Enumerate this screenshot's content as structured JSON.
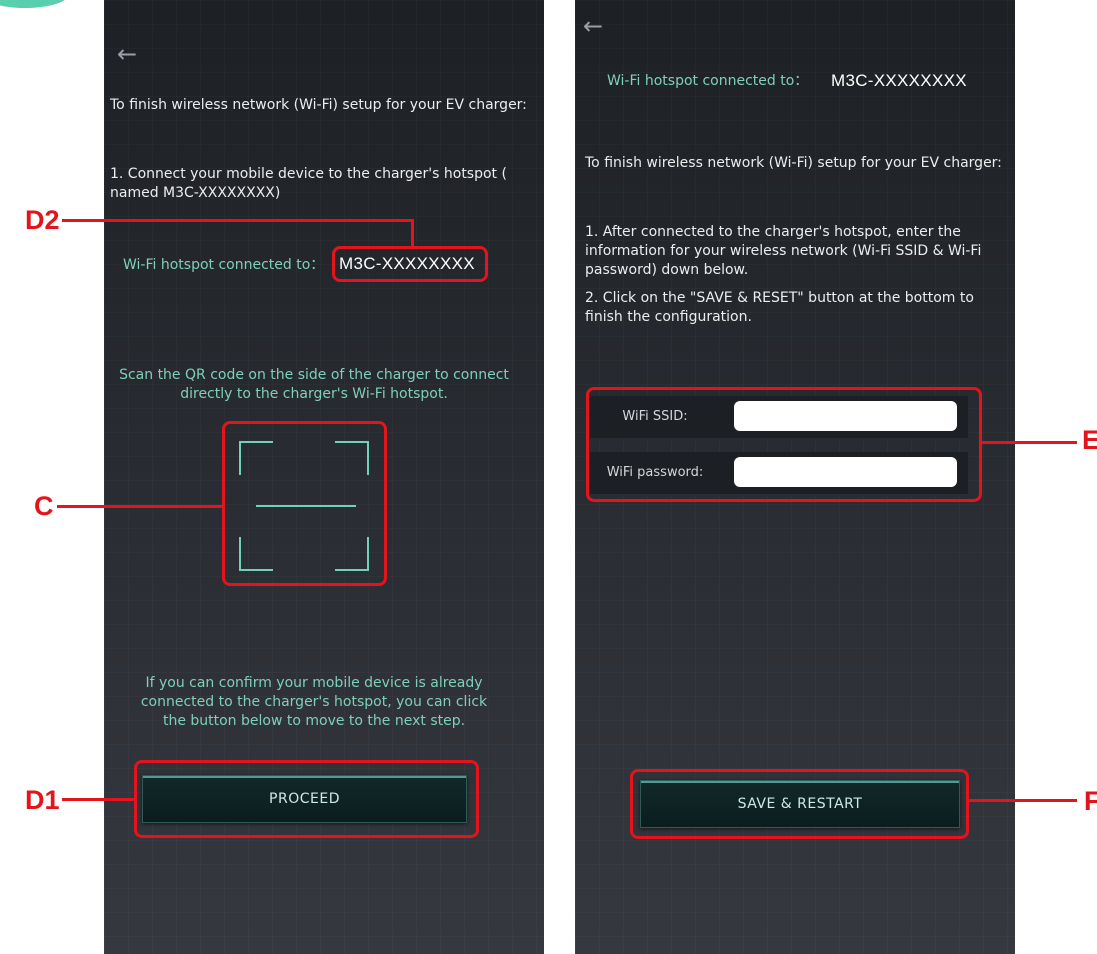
{
  "left_screen": {
    "back_arrow": "←",
    "intro_text": "To finish wireless network (Wi-Fi) setup for your EV charger:",
    "step1_text": "1. Connect your mobile device to the charger's hotspot ( named M3C-XXXXXXXX)",
    "hotspot_label": "Wi-Fi hotspot connected to：",
    "hotspot_value": "M3C-XXXXXXXX",
    "scan_text": "Scan the QR code on the side of the charger to connect directly to the charger's Wi-Fi hotspot.",
    "confirm_text": "If you can confirm your mobile device is already connected to the charger's hotspot, you can click the button below to move to the next step.",
    "proceed_label": "PROCEED"
  },
  "right_screen": {
    "back_arrow": "←",
    "hotspot_label": "Wi-Fi hotspot connected to：",
    "hotspot_value": "M3C-XXXXXXXX",
    "intro_text": "To finish wireless network (Wi-Fi) setup for your EV charger:",
    "step1_text": "1. After connected to the charger's hotspot, enter the information for your wireless network (Wi-Fi SSID & Wi-Fi password) down below.",
    "step2_text": "2. Click on the \"SAVE & RESET\" button at the bottom to finish the configuration.",
    "ssid_label": "WiFi SSID:",
    "ssid_value": "",
    "password_label": "WiFi password:",
    "password_value": "",
    "save_label": "SAVE & RESTART"
  },
  "callouts": {
    "d2": "D2",
    "c": "C",
    "d1": "D1",
    "e": "E",
    "f": "F"
  },
  "colors": {
    "callout": "#e3141b",
    "teal": "#7fd0b8",
    "background": "#24272c"
  }
}
